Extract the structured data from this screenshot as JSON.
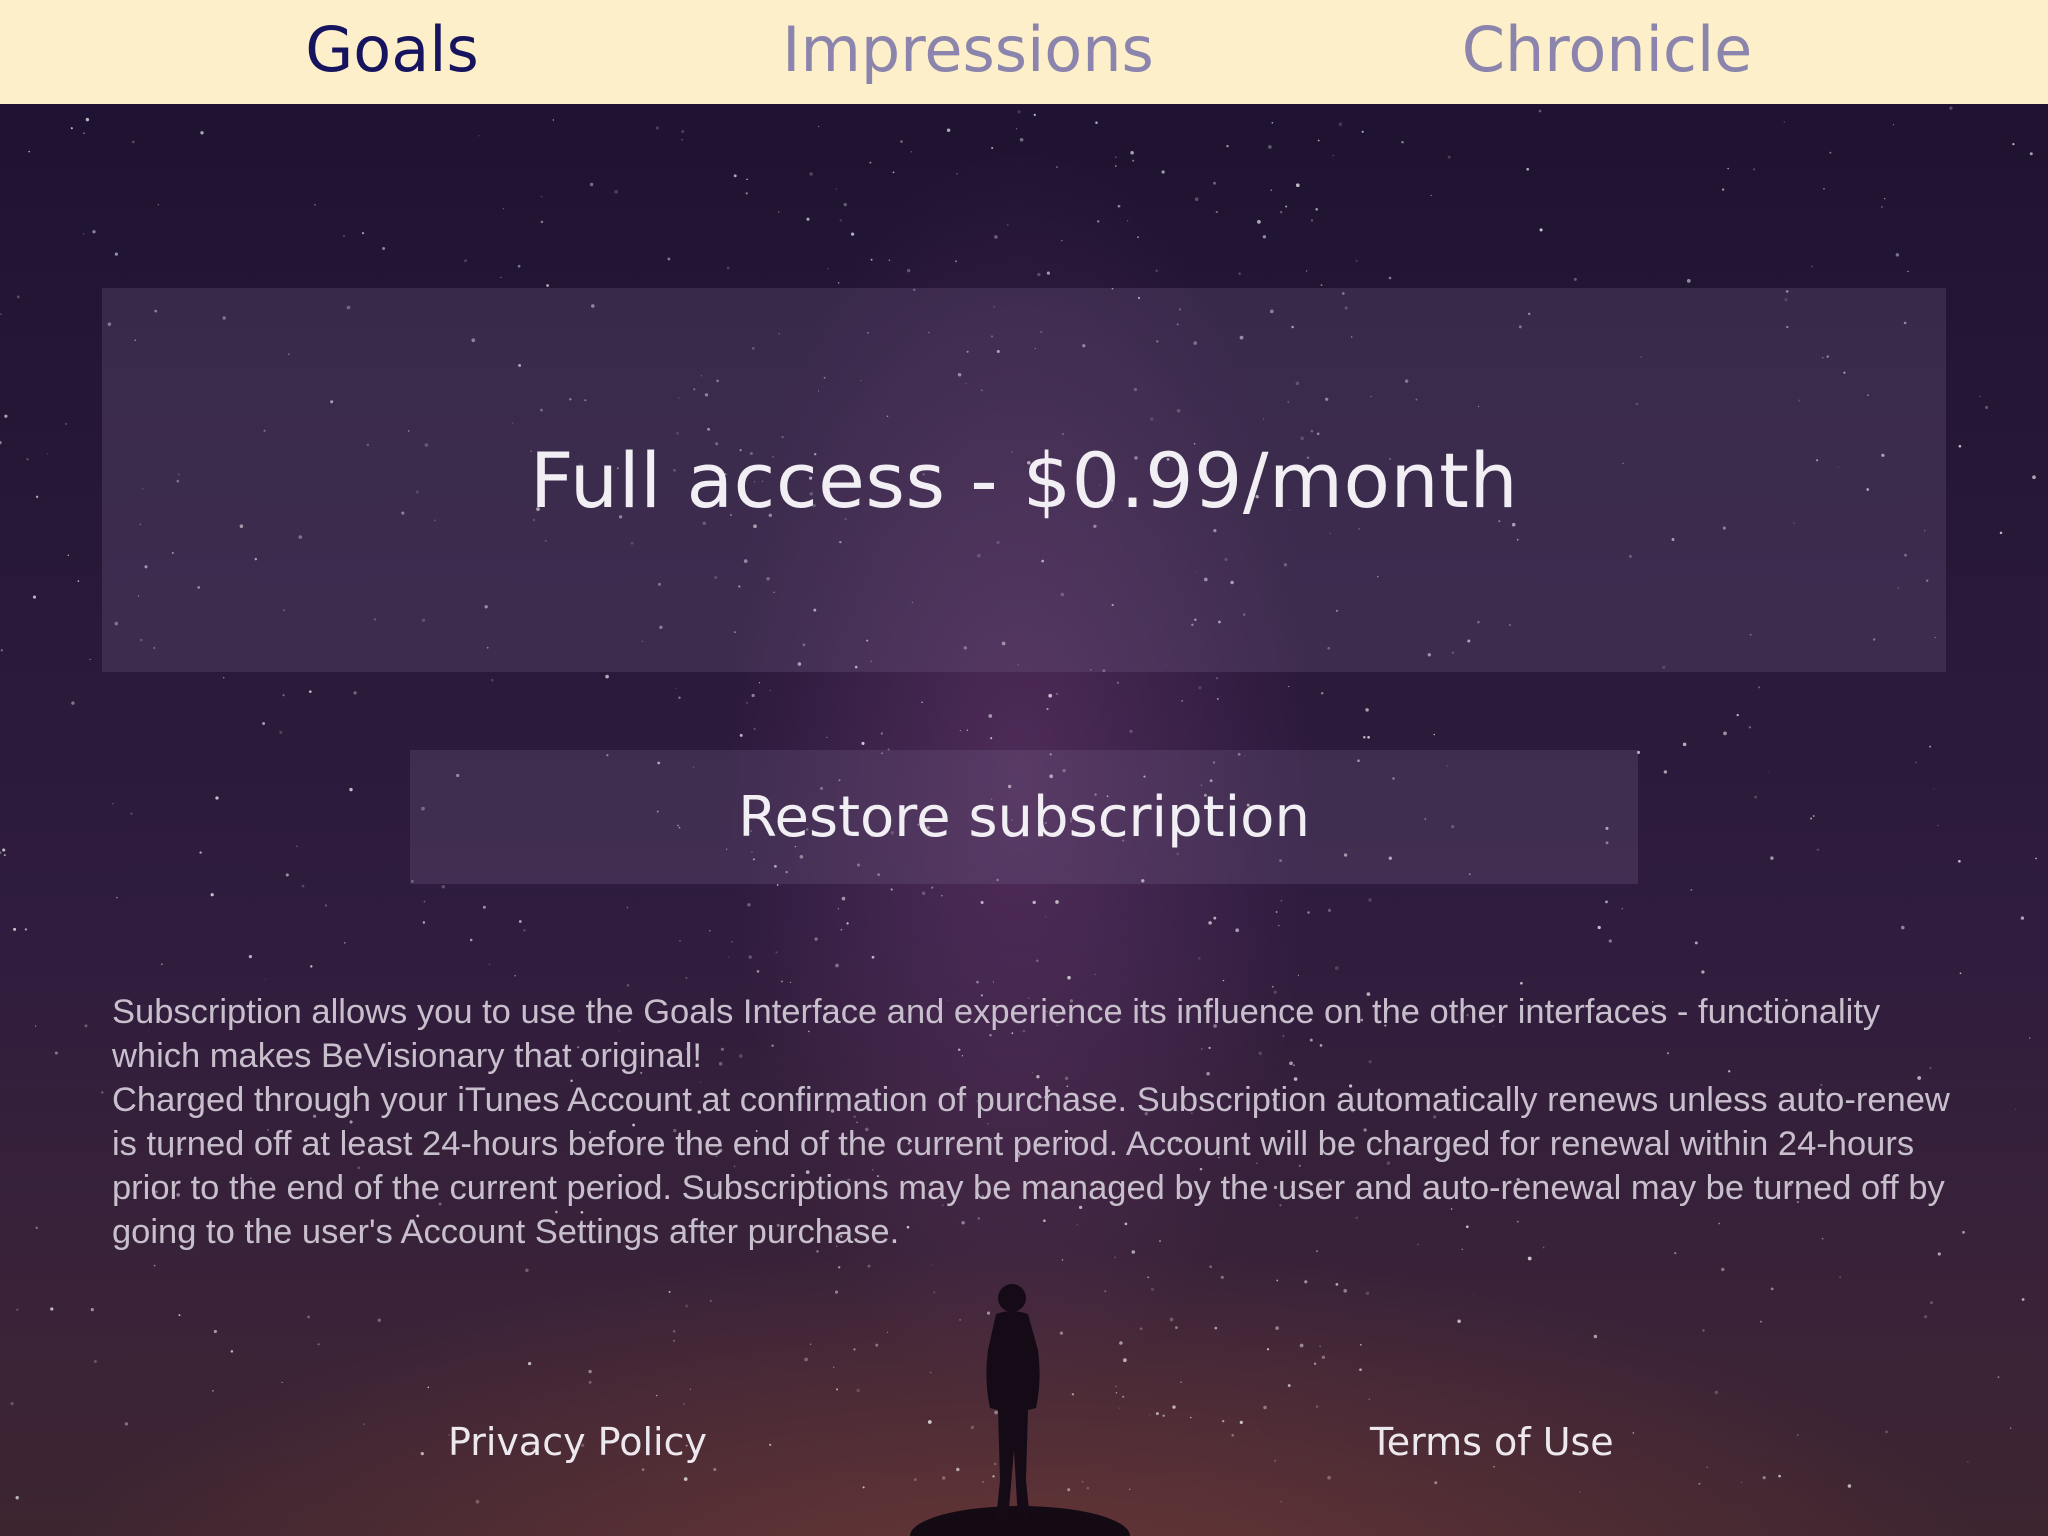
{
  "tabs": [
    {
      "label": "Goals",
      "active": true
    },
    {
      "label": "Impressions",
      "active": false
    },
    {
      "label": "Chronicle",
      "active": false
    }
  ],
  "purchase": {
    "label": "Full access - $0.99/month"
  },
  "restore": {
    "label": "Restore subscription"
  },
  "disclaimer": {
    "paragraph1": "Subscription allows you to use the Goals Interface and experience its influence on the other interfaces - functionality which makes BeVisionary that original!",
    "paragraph2": "Charged through your iTunes Account at confirmation of purchase. Subscription automatically renews unless auto-renew is turned off at least 24-hours before the end of the current period. Account will be charged for renewal within 24-hours prior to the end of the current period. Subscriptions may be managed by the user and auto-renewal may be turned off by going to the user's Account Settings after purchase."
  },
  "footer": {
    "privacy_label": "Privacy Policy",
    "terms_label": "Terms of Use"
  },
  "colors": {
    "tabbar_background": "#fdefc9",
    "tab_active": "#17145f",
    "tab_inactive": "#8b84ad"
  }
}
